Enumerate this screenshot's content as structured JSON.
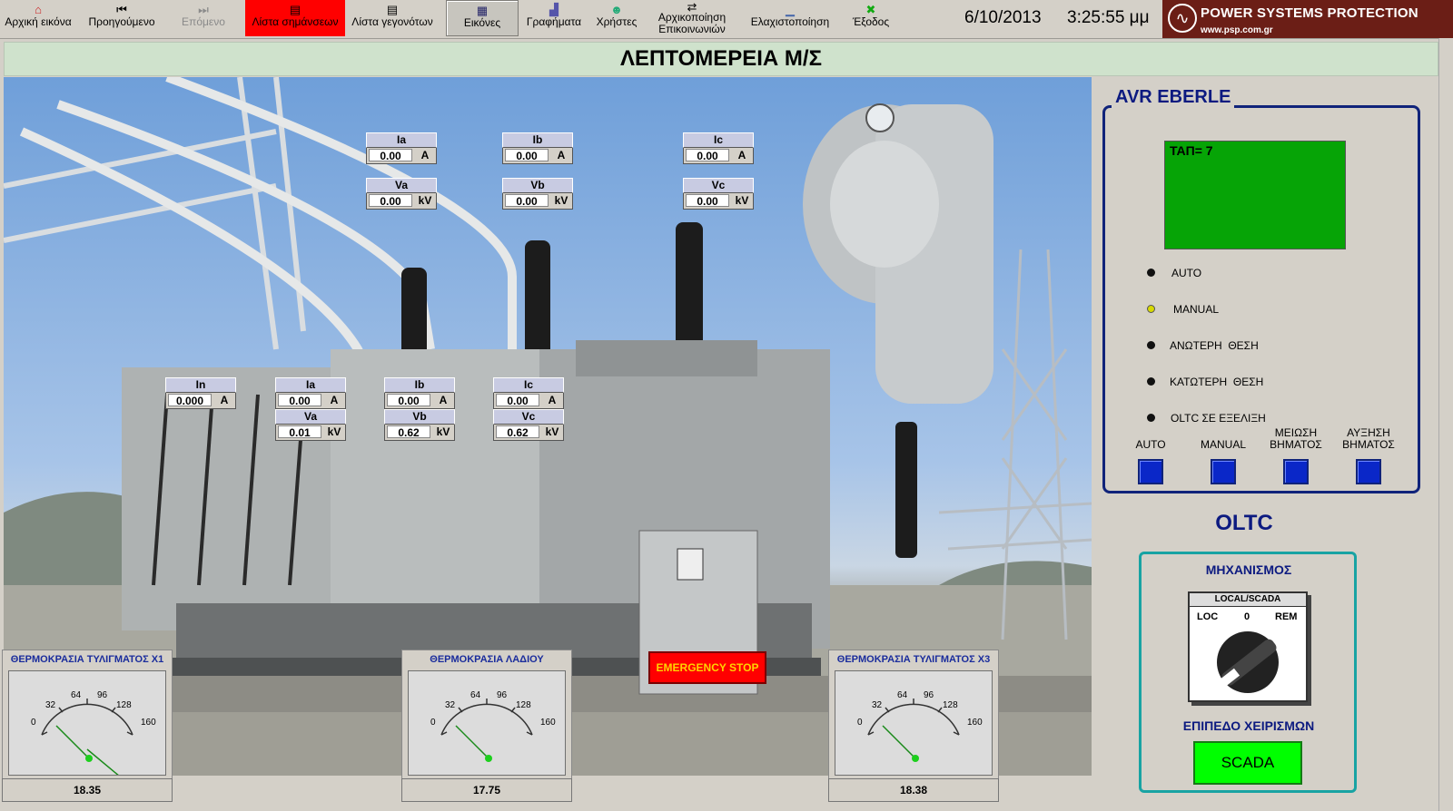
{
  "toolbar": {
    "items": [
      {
        "label": "Αρχική εικόνα",
        "icon": "home-icon",
        "glyph": "⌂",
        "state": "normal"
      },
      {
        "label": "Προηγούμενο",
        "icon": "previous-icon",
        "glyph": "⏮",
        "state": "normal"
      },
      {
        "label": "Επόμενο",
        "icon": "next-icon",
        "glyph": "⏭",
        "state": "disabled"
      },
      {
        "label": "Λίστα σημάνσεων",
        "icon": "alarm-list-icon",
        "glyph": "▤",
        "state": "active"
      },
      {
        "label": "Λίστα γεγονότων",
        "icon": "event-list-icon",
        "glyph": "▤",
        "state": "normal"
      },
      {
        "label": "Εικόνες",
        "icon": "pictures-icon",
        "glyph": "▦",
        "state": "pressed"
      },
      {
        "label": "Γραφήματα",
        "icon": "graphs-icon",
        "glyph": "📈",
        "state": "normal"
      },
      {
        "label": "Χρήστες",
        "icon": "users-icon",
        "glyph": "☻",
        "state": "normal"
      },
      {
        "label1": "Αρχικοποίηση",
        "label2": "Επικοινωνιών",
        "icon": "comm-init-icon",
        "glyph": "⇄",
        "state": "normal"
      },
      {
        "label": "Ελαχιστοποίηση",
        "icon": "minimize-icon",
        "glyph": "▁",
        "state": "normal"
      },
      {
        "label": "Έξοδος",
        "icon": "exit-icon",
        "glyph": "✖",
        "state": "normal"
      }
    ],
    "date": "6/10/2013",
    "time": "3:25:55 μμ"
  },
  "logo": {
    "name": "POWER SYSTEMS PROTECTION",
    "url": "www.psp.com.gr"
  },
  "title": "ΛΕΠΤΟΜΕΡΕΙΑ Μ/Σ",
  "upper_meters": [
    {
      "label": "Ia",
      "value": "0.00",
      "unit": "A"
    },
    {
      "label": "Va",
      "value": "0.00",
      "unit": "kV"
    },
    {
      "label": "Ib",
      "value": "0.00",
      "unit": "A"
    },
    {
      "label": "Vb",
      "value": "0.00",
      "unit": "kV"
    },
    {
      "label": "Ic",
      "value": "0.00",
      "unit": "A"
    },
    {
      "label": "Vc",
      "value": "0.00",
      "unit": "kV"
    }
  ],
  "lower_meters": [
    {
      "label": "In",
      "value": "0.000",
      "unit": "A"
    },
    {
      "label": "Ia",
      "value": "0.00",
      "unit": "A"
    },
    {
      "label": "Va",
      "value": "0.01",
      "unit": "kV"
    },
    {
      "label": "Ib",
      "value": "0.00",
      "unit": "A"
    },
    {
      "label": "Vb",
      "value": "0.62",
      "unit": "kV"
    },
    {
      "label": "Ic",
      "value": "0.00",
      "unit": "A"
    },
    {
      "label": "Vc",
      "value": "0.62",
      "unit": "kV"
    }
  ],
  "gauges": [
    {
      "title": "ΘΕΡΜΟΚΡΑΣΙΑ ΤΥΛΙΓΜΑΤΟΣ Χ1",
      "value": "18.35"
    },
    {
      "title": "ΘΕΡΜΟΚΡΑΣΙΑ ΛΑΔΙΟΥ",
      "value": "17.75"
    },
    {
      "title": "ΘΕΡΜΟΚΡΑΣΙΑ ΤΥΛΙΓΜΑΤΟΣ Χ3",
      "value": "18.38"
    }
  ],
  "gauge_ticks": [
    "0",
    "32",
    "64",
    "96",
    "128",
    "160"
  ],
  "emergency_stop": "EMERGENCY STOP",
  "avr": {
    "title": "AVR EBERLE",
    "tap_display": "ΤΑΠ= 7",
    "indicators": [
      {
        "label": "AUTO",
        "on": false
      },
      {
        "label": "MANUAL",
        "on": true
      },
      {
        "label": "ΑΝΩΤΕΡΗ  ΘΕΣΗ",
        "on": false
      },
      {
        "label": "ΚΑΤΩΤΕΡΗ  ΘΕΣΗ",
        "on": false
      },
      {
        "label": "OLTC ΣΕ ΕΞΕΛΙΞΗ",
        "on": false
      }
    ],
    "buttons": [
      {
        "line1": "AUTO",
        "line2": ""
      },
      {
        "line1": "MANUAL",
        "line2": ""
      },
      {
        "line1": "ΜΕΙΩΣΗ",
        "line2": "ΒΗΜΑΤΟΣ"
      },
      {
        "line1": "ΑΥΞΗΣΗ",
        "line2": "ΒΗΜΑΤΟΣ"
      }
    ]
  },
  "oltc": {
    "title": "OLTC",
    "mechanism_label": "ΜΗΧΑΝΙΣΜΟΣ",
    "selector_title": "LOCAL/SCADA",
    "selector_loc": "LOC",
    "selector_zero": "0",
    "selector_rem": "REM",
    "level_label": "ΕΠΙΠΕΔΟ ΧΕΙΡΙΣΜΩΝ",
    "level_value": "SCADA"
  }
}
